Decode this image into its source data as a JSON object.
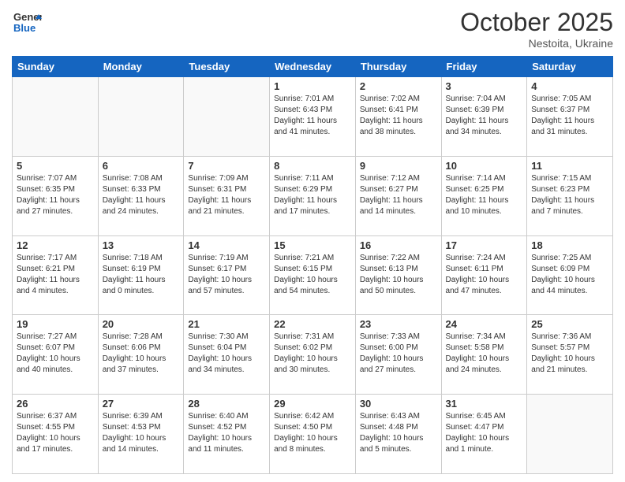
{
  "header": {
    "logo_general": "General",
    "logo_blue": "Blue",
    "month_title": "October 2025",
    "location": "Nestoita, Ukraine"
  },
  "weekdays": [
    "Sunday",
    "Monday",
    "Tuesday",
    "Wednesday",
    "Thursday",
    "Friday",
    "Saturday"
  ],
  "weeks": [
    [
      {
        "day": "",
        "info": ""
      },
      {
        "day": "",
        "info": ""
      },
      {
        "day": "",
        "info": ""
      },
      {
        "day": "1",
        "info": "Sunrise: 7:01 AM\nSunset: 6:43 PM\nDaylight: 11 hours\nand 41 minutes."
      },
      {
        "day": "2",
        "info": "Sunrise: 7:02 AM\nSunset: 6:41 PM\nDaylight: 11 hours\nand 38 minutes."
      },
      {
        "day": "3",
        "info": "Sunrise: 7:04 AM\nSunset: 6:39 PM\nDaylight: 11 hours\nand 34 minutes."
      },
      {
        "day": "4",
        "info": "Sunrise: 7:05 AM\nSunset: 6:37 PM\nDaylight: 11 hours\nand 31 minutes."
      }
    ],
    [
      {
        "day": "5",
        "info": "Sunrise: 7:07 AM\nSunset: 6:35 PM\nDaylight: 11 hours\nand 27 minutes."
      },
      {
        "day": "6",
        "info": "Sunrise: 7:08 AM\nSunset: 6:33 PM\nDaylight: 11 hours\nand 24 minutes."
      },
      {
        "day": "7",
        "info": "Sunrise: 7:09 AM\nSunset: 6:31 PM\nDaylight: 11 hours\nand 21 minutes."
      },
      {
        "day": "8",
        "info": "Sunrise: 7:11 AM\nSunset: 6:29 PM\nDaylight: 11 hours\nand 17 minutes."
      },
      {
        "day": "9",
        "info": "Sunrise: 7:12 AM\nSunset: 6:27 PM\nDaylight: 11 hours\nand 14 minutes."
      },
      {
        "day": "10",
        "info": "Sunrise: 7:14 AM\nSunset: 6:25 PM\nDaylight: 11 hours\nand 10 minutes."
      },
      {
        "day": "11",
        "info": "Sunrise: 7:15 AM\nSunset: 6:23 PM\nDaylight: 11 hours\nand 7 minutes."
      }
    ],
    [
      {
        "day": "12",
        "info": "Sunrise: 7:17 AM\nSunset: 6:21 PM\nDaylight: 11 hours\nand 4 minutes."
      },
      {
        "day": "13",
        "info": "Sunrise: 7:18 AM\nSunset: 6:19 PM\nDaylight: 11 hours\nand 0 minutes."
      },
      {
        "day": "14",
        "info": "Sunrise: 7:19 AM\nSunset: 6:17 PM\nDaylight: 10 hours\nand 57 minutes."
      },
      {
        "day": "15",
        "info": "Sunrise: 7:21 AM\nSunset: 6:15 PM\nDaylight: 10 hours\nand 54 minutes."
      },
      {
        "day": "16",
        "info": "Sunrise: 7:22 AM\nSunset: 6:13 PM\nDaylight: 10 hours\nand 50 minutes."
      },
      {
        "day": "17",
        "info": "Sunrise: 7:24 AM\nSunset: 6:11 PM\nDaylight: 10 hours\nand 47 minutes."
      },
      {
        "day": "18",
        "info": "Sunrise: 7:25 AM\nSunset: 6:09 PM\nDaylight: 10 hours\nand 44 minutes."
      }
    ],
    [
      {
        "day": "19",
        "info": "Sunrise: 7:27 AM\nSunset: 6:07 PM\nDaylight: 10 hours\nand 40 minutes."
      },
      {
        "day": "20",
        "info": "Sunrise: 7:28 AM\nSunset: 6:06 PM\nDaylight: 10 hours\nand 37 minutes."
      },
      {
        "day": "21",
        "info": "Sunrise: 7:30 AM\nSunset: 6:04 PM\nDaylight: 10 hours\nand 34 minutes."
      },
      {
        "day": "22",
        "info": "Sunrise: 7:31 AM\nSunset: 6:02 PM\nDaylight: 10 hours\nand 30 minutes."
      },
      {
        "day": "23",
        "info": "Sunrise: 7:33 AM\nSunset: 6:00 PM\nDaylight: 10 hours\nand 27 minutes."
      },
      {
        "day": "24",
        "info": "Sunrise: 7:34 AM\nSunset: 5:58 PM\nDaylight: 10 hours\nand 24 minutes."
      },
      {
        "day": "25",
        "info": "Sunrise: 7:36 AM\nSunset: 5:57 PM\nDaylight: 10 hours\nand 21 minutes."
      }
    ],
    [
      {
        "day": "26",
        "info": "Sunrise: 6:37 AM\nSunset: 4:55 PM\nDaylight: 10 hours\nand 17 minutes."
      },
      {
        "day": "27",
        "info": "Sunrise: 6:39 AM\nSunset: 4:53 PM\nDaylight: 10 hours\nand 14 minutes."
      },
      {
        "day": "28",
        "info": "Sunrise: 6:40 AM\nSunset: 4:52 PM\nDaylight: 10 hours\nand 11 minutes."
      },
      {
        "day": "29",
        "info": "Sunrise: 6:42 AM\nSunset: 4:50 PM\nDaylight: 10 hours\nand 8 minutes."
      },
      {
        "day": "30",
        "info": "Sunrise: 6:43 AM\nSunset: 4:48 PM\nDaylight: 10 hours\nand 5 minutes."
      },
      {
        "day": "31",
        "info": "Sunrise: 6:45 AM\nSunset: 4:47 PM\nDaylight: 10 hours\nand 1 minute."
      },
      {
        "day": "",
        "info": ""
      }
    ]
  ]
}
